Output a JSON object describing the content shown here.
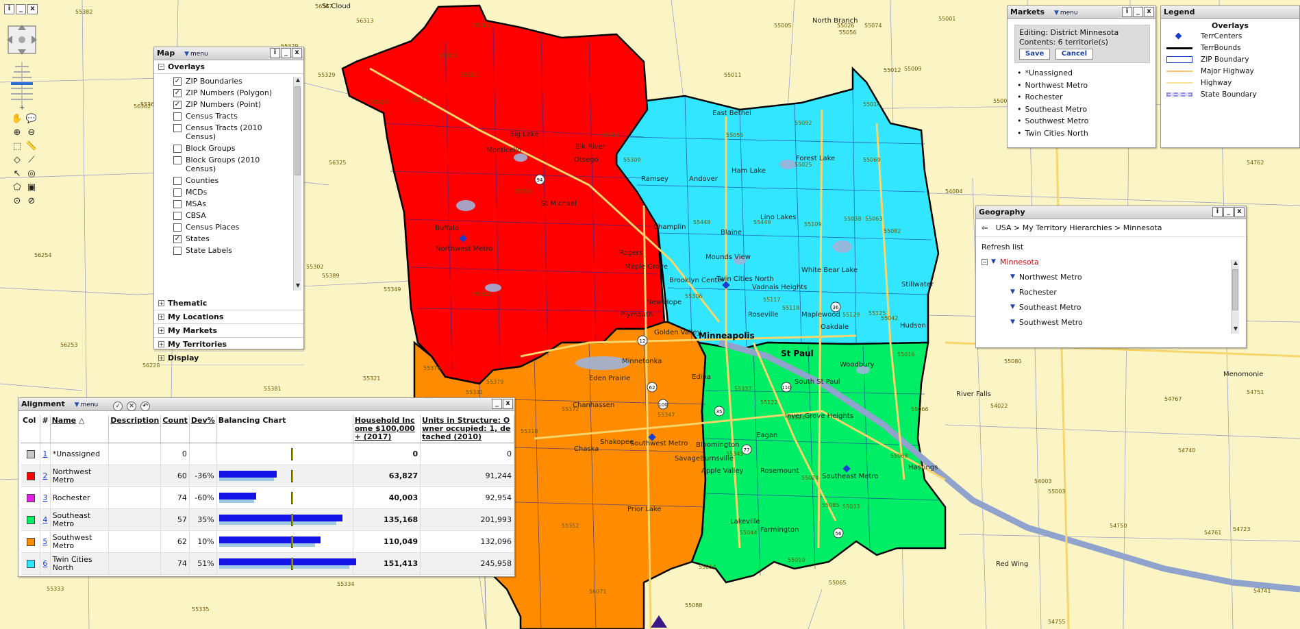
{
  "colors": {
    "northwest": "#ff0000",
    "southeast": "#00ee66",
    "southwest": "#ff8c00",
    "twincities": "#33e6ff",
    "rochester": "#e020e0",
    "unassigned": "#c8c8c8",
    "map_background": "#fbf4c4",
    "water": "#9fb2d8",
    "highway": "#f6d56a"
  },
  "map": {
    "zip_labels": [
      "55304",
      "55303",
      "55330",
      "55309",
      "55362",
      "55313",
      "55301",
      "55320",
      "55376",
      "55358",
      "55390",
      "55379",
      "55372",
      "55347",
      "55318",
      "55352",
      "55025",
      "55092",
      "55038",
      "55014",
      "55448",
      "55449",
      "55055",
      "55117",
      "55082",
      "55125",
      "55016",
      "55122",
      "55124",
      "55068",
      "55033",
      "55024",
      "55085",
      "55044",
      "55010",
      "55005",
      "55011",
      "55056",
      "55074",
      "55012",
      "55069",
      "55063",
      "54004",
      "54017",
      "55065",
      "55088",
      "55054",
      "56071",
      "55382",
      "55381",
      "55321",
      "55302",
      "56228",
      "56253",
      "55333",
      "55335",
      "55334",
      "55349",
      "55389",
      "56362",
      "56313",
      "56254",
      "55329",
      "55009",
      "55066",
      "54022",
      "54003",
      "54723",
      "54750",
      "54761",
      "54767",
      "54762",
      "54740",
      "54751",
      "54741",
      "54755",
      "55026",
      "55118",
      "55129",
      "55109",
      "55042",
      "56367",
      "55329",
      "56325",
      "55001",
      "55006",
      "55080",
      "55003",
      "55331",
      "55317",
      "55306",
      "55337",
      "55345"
    ],
    "places": [
      "St Cloud",
      "North Branch",
      "Elk River",
      "Big Lake",
      "Monticello",
      "Otsego",
      "St Michael",
      "Buffalo",
      "Northwest Metro",
      "Rogers",
      "Maple Grove",
      "Plymouth",
      "Ramsey",
      "Andover",
      "Ham Lake",
      "East Bethel",
      "Forest Lake",
      "Lino Lakes",
      "White Bear Lake",
      "Blaine",
      "Champlin",
      "Brooklyn Center",
      "Twin Cities North",
      "Mounds View",
      "Roseville",
      "Maplewood",
      "Oakdale",
      "Woodbury",
      "Vadnais Heights",
      "New Hope",
      "Golden Valley",
      "Minnetonka",
      "Edina",
      "Chanhassen",
      "Chaska",
      "Shakopee",
      "Southwest Metro",
      "Savage",
      "Prior Lake",
      "Bloomington",
      "Burnsville",
      "Apple Valley",
      "Rosemount",
      "Eagan",
      "Inver Grove Heights",
      "South St Paul",
      "Southeast Metro",
      "Hastings",
      "Lakeville",
      "Farmington",
      "Hudson",
      "Stillwater",
      "Menomonie",
      "River Falls",
      "Red Wing",
      "Eden Prairie"
    ],
    "city_major": [
      "Minneapolis",
      "St Paul"
    ],
    "route_shields": [
      "94",
      "12",
      "62",
      "100",
      "110",
      "77",
      "56",
      "36",
      "35"
    ]
  },
  "toolbar": {
    "info": "i",
    "minimize": "_",
    "close": "x"
  },
  "map_panel": {
    "title": "Map",
    "menu_label": "menu",
    "overlays_label": "Overlays",
    "overlays": [
      {
        "label": "ZIP Boundaries",
        "checked": true
      },
      {
        "label": "ZIP Numbers (Polygon)",
        "checked": true
      },
      {
        "label": "ZIP Numbers (Point)",
        "checked": true
      },
      {
        "label": "Census Tracts",
        "checked": false
      },
      {
        "label": "Census Tracts (2010 Census)",
        "checked": false
      },
      {
        "label": "Block Groups",
        "checked": false
      },
      {
        "label": "Block Groups (2010 Census)",
        "checked": false
      },
      {
        "label": "Counties",
        "checked": false
      },
      {
        "label": "MCDs",
        "checked": false
      },
      {
        "label": "MSAs",
        "checked": false
      },
      {
        "label": "CBSA",
        "checked": false
      },
      {
        "label": "Census Places",
        "checked": false
      },
      {
        "label": "States",
        "checked": true
      },
      {
        "label": "State Labels",
        "checked": false
      }
    ],
    "sections": [
      "Thematic",
      "My Locations",
      "My Markets",
      "My Territories",
      "Display"
    ]
  },
  "markets_panel": {
    "title": "Markets",
    "menu_label": "menu",
    "editing_text": "Editing: District Minnesota",
    "contents_text": "Contents: 6 territorie(s)",
    "save_label": "Save",
    "cancel_label": "Cancel",
    "territories": [
      "*Unassigned",
      "Northwest Metro",
      "Rochester",
      "Southeast Metro",
      "Southwest Metro",
      "Twin Cities North"
    ]
  },
  "legend_panel": {
    "title": "Legend",
    "overlays_title": "Overlays",
    "items": [
      {
        "label": "TerrCenters",
        "kind": "diamond",
        "color": "#1a3dd0"
      },
      {
        "label": "TerrBounds",
        "kind": "thick-line",
        "color": "#000000"
      },
      {
        "label": "ZIP Boundary",
        "kind": "box",
        "color": "#1a3dd0"
      },
      {
        "label": "Major Highway",
        "kind": "line",
        "color": "#f6c56a"
      },
      {
        "label": "Highway",
        "kind": "line",
        "color": "#f6e09a"
      },
      {
        "label": "State Boundary",
        "kind": "dash",
        "color": "#8f8fe0"
      }
    ]
  },
  "geo_panel": {
    "title": "Geography",
    "breadcrumb": [
      "USA",
      "My Territory Hierarchies",
      "Minnesota"
    ],
    "refresh_label": "Refresh list",
    "root": "Minnesota",
    "children": [
      "Northwest Metro",
      "Rochester",
      "Southeast Metro",
      "Southwest Metro"
    ]
  },
  "align_panel": {
    "title": "Alignment",
    "menu_label": "menu",
    "columns": {
      "col": "Col",
      "num": "#",
      "name": "Name",
      "description": "Description",
      "count": "Count",
      "dev": "Dev%",
      "balancing": "Balancing Chart",
      "income": "Household Income $100,000+ (2017)",
      "units": "Units in Structure: Owner occupied: 1, detached (2010)"
    },
    "rows": [
      {
        "num": "1",
        "name": "*Unassigned",
        "color": "#c8c8c8",
        "description": "",
        "count": "0",
        "dev": "",
        "balance": 0,
        "income": "0",
        "units": "0"
      },
      {
        "num": "2",
        "name": "Northwest Metro",
        "color": "#ff0000",
        "description": "",
        "count": "60",
        "dev": "-36%",
        "balance": 0.42,
        "income": "63,827",
        "units": "91,244"
      },
      {
        "num": "3",
        "name": "Rochester",
        "color": "#e020e0",
        "description": "",
        "count": "74",
        "dev": "-60%",
        "balance": 0.27,
        "income": "40,003",
        "units": "92,954"
      },
      {
        "num": "4",
        "name": "Southeast Metro",
        "color": "#00ee66",
        "description": "",
        "count": "57",
        "dev": "35%",
        "balance": 0.9,
        "income": "135,168",
        "units": "201,993"
      },
      {
        "num": "5",
        "name": "Southwest Metro",
        "color": "#ff8c00",
        "description": "",
        "count": "62",
        "dev": "10%",
        "balance": 0.74,
        "income": "110,049",
        "units": "132,096"
      },
      {
        "num": "6",
        "name": "Twin Cities North",
        "color": "#33e6ff",
        "description": "",
        "count": "74",
        "dev": "51%",
        "balance": 1.0,
        "income": "151,413",
        "units": "245,958"
      }
    ]
  }
}
